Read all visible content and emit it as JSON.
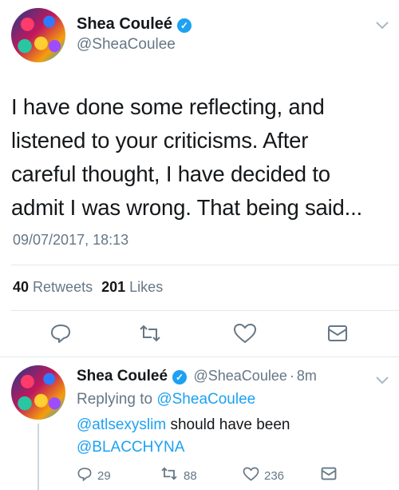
{
  "main_tweet": {
    "display_name": "Shea Couleé",
    "handle": "@SheaCoulee",
    "text_lines": [
      "I have done some reflecting, and",
      "listened to your criticisms. After",
      "careful thought, I have decided to",
      "admit I was wrong. That being said..."
    ],
    "timestamp": "09/07/2017, 18:13",
    "retweets_count": "40",
    "retweets_label": "Retweets",
    "likes_count": "201",
    "likes_label": "Likes"
  },
  "reply_tweet": {
    "display_name": "Shea Couleé",
    "handle": "@SheaCoulee",
    "separator": "·",
    "time_ago": "8m",
    "replying_prefix": "Replying to",
    "replying_to": "@SheaCoulee",
    "mention1": "@atlsexyslim",
    "text_rest": "should have been",
    "mention2": "@BLACCHYNA",
    "reply_count": "29",
    "retweet_count": "88",
    "like_count": "236"
  },
  "icons": {
    "verified": "verified-badge-icon",
    "chevron": "chevron-down-icon",
    "reply": "reply-icon",
    "retweet": "retweet-icon",
    "like": "heart-icon",
    "dm": "envelope-icon"
  },
  "colors": {
    "accent": "#1da1f2",
    "text": "#14171a",
    "secondary": "#657786",
    "divider": "#e1e8ed"
  }
}
